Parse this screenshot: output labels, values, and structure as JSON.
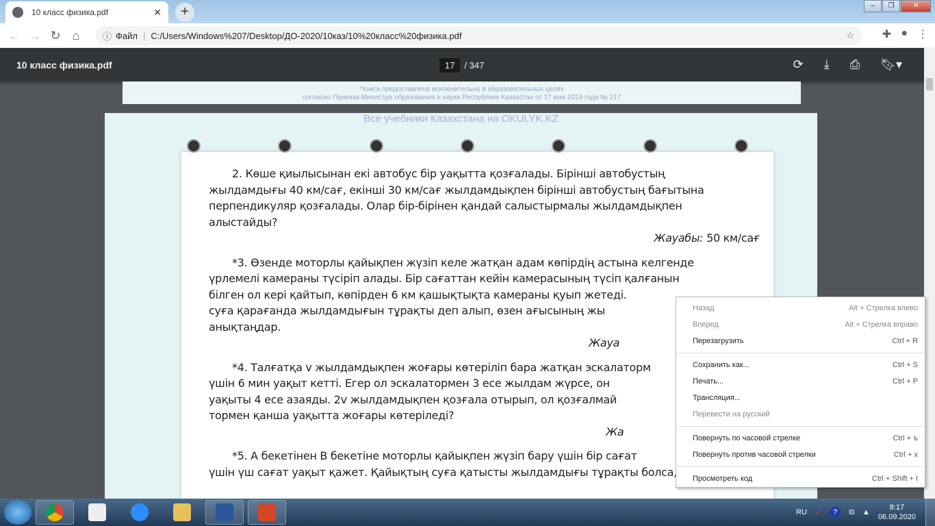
{
  "browser": {
    "tab_title": "10 класс физика.pdf",
    "address_label": "Файл",
    "url": "C:/Users/Windows%207/Desktop/ДО-2020/10каз/10%20класс%20физика.pdf"
  },
  "pdf": {
    "title": "10 класс физика.pdf",
    "current_page": "17",
    "total_pages": "/ 347"
  },
  "page_top": {
    "line1": "*Книга предоставлена исключительно в образовательных целях",
    "line2": "согласно Приказа Министра образования и науки Республики Казахстан от 17 мая 2019 года № 217"
  },
  "page_header": "Все учебники Казахстана на OKULYK.KZ",
  "content": {
    "l1": "2. Көше қиылысынан екі автобус бір уақытта қозғалады. Бірінші автобустың",
    "l2": "жылдамдығы 40 км/сағ, екінші 30 км/сағ жылдамдықпен бірінші автобустың бағытына",
    "l3": "перпендикуляр қозғалады. Олар бір-бірінен қандай салыстырмалы жылдамдықпен",
    "l4": "алыстайды?",
    "a2_label": "Жауабы:",
    "a2_value": " 50 км/сағ",
    "l5": "*3. Өзенде моторлы қайықпен жүзіп келе жатқан адам көпірдің астына келгенде",
    "l6": "үрлемелі камераны түсіріп алады. Бір сағаттан кейін камерасының түсіп қалғанын",
    "l7": "білген ол кері қайтып, көпірден 6 км қашықтықта камераны қуып жетеді.",
    "l8": "суға қарағанда жылдамдығын тұрақты деп алып, өзен ағысының жы",
    "l9": "анықтаңдар.",
    "a3": "Жауа",
    "l10": "*4. Талғатқа v жылдамдықпен жоғары көтеріліп бара жатқан эскалаторм",
    "l11": "үшін 6 мин уақыт кетті. Егер ол эскалатормен 3 есе жылдам жүрсе, он",
    "l12": "уақыты 4 есе азаяды. 2v жылдамдықпен қозғала отырып, ол қозғалмай",
    "l13": "тормен қанша уақытта жоғары көтеріледі?",
    "a4": "Жа",
    "l14": "*5. А бекетінен В бекетіне моторлы қайықпен жүзіп бару үшін бір сағат",
    "l15": "үшін үш сағат уақыт қажет. Қайықтың суға қатысты жылдамдығы тұрақты болса, бұл"
  },
  "menu": {
    "items": [
      {
        "label": "Назад",
        "shortcut": "Alt + Стрелка влево"
      },
      {
        "label": "Вперед",
        "shortcut": "Alt + Стрелка вправо"
      },
      {
        "label": "Перезагрузить",
        "shortcut": "Ctrl + R"
      },
      {
        "label": "Сохранить как...",
        "shortcut": "Ctrl + S"
      },
      {
        "label": "Печать...",
        "shortcut": "Ctrl + P"
      },
      {
        "label": "Трансляция...",
        "shortcut": ""
      },
      {
        "label": "Перевести на русский",
        "shortcut": ""
      },
      {
        "label": "Повернуть по часовой стрелке",
        "shortcut": "Ctrl + ъ"
      },
      {
        "label": "Повернуть против часовой стрелки",
        "shortcut": "Ctrl + x"
      },
      {
        "label": "Просмотреть код",
        "shortcut": "Ctrl + Shift + I"
      }
    ]
  },
  "taskbar": {
    "lang": "RU",
    "time": "8:17",
    "date": "06.09.2020"
  }
}
